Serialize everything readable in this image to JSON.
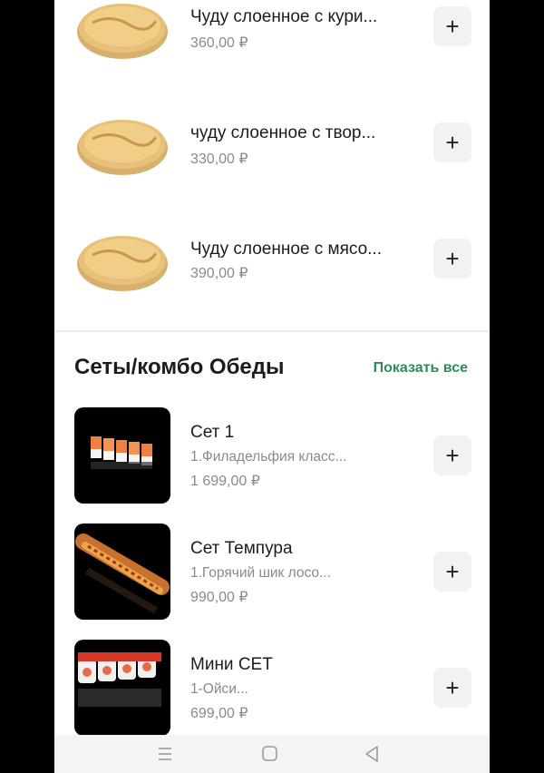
{
  "pies": [
    {
      "title": "Чуду слоенное с кури...",
      "price": "360,00 ₽"
    },
    {
      "title": "чуду слоенное с твор...",
      "price": "330,00 ₽"
    },
    {
      "title": "Чуду слоенное с мясо...",
      "price": "390,00 ₽"
    }
  ],
  "section": {
    "title": "Сеты/комбо Обеды",
    "show_all": "Показать все"
  },
  "sets": [
    {
      "title": "Сет 1",
      "desc": "1.Филадельфия класс...",
      "price": "1 699,00 ₽"
    },
    {
      "title": "Сет Темпура",
      "desc": "1.Горячий шик лосо...",
      "price": "990,00 ₽"
    },
    {
      "title": "Мини СЕТ",
      "desc": "1-Ойси...",
      "price": "699,00 ₽"
    }
  ],
  "add_label": "+",
  "colors": {
    "accent": "#2e8b57",
    "background": "#000000"
  }
}
